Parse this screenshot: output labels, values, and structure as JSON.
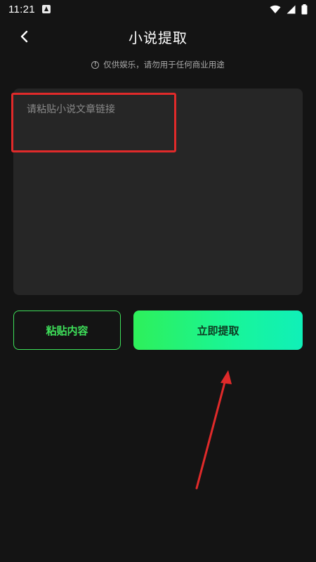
{
  "status_bar": {
    "time": "11:21",
    "icons": [
      "app-notification-icon",
      "wifi-icon",
      "signal-icon",
      "battery-icon"
    ]
  },
  "nav": {
    "title": "小说提取",
    "back_icon": "chevron-left-icon"
  },
  "disclaimer": {
    "icon": "info-icon",
    "icon_glyph": "!",
    "text": "仅供娱乐，请勿用于任何商业用途"
  },
  "input": {
    "placeholder": "请粘贴小说文章链接",
    "value": ""
  },
  "actions": {
    "paste_label": "粘贴内容",
    "extract_label": "立即提取"
  },
  "colors": {
    "background": "#141414",
    "panel": "#262626",
    "accent_green": "#3ee05a",
    "gradient_end": "#10f0b8",
    "annotation_red": "#e02a2a"
  }
}
